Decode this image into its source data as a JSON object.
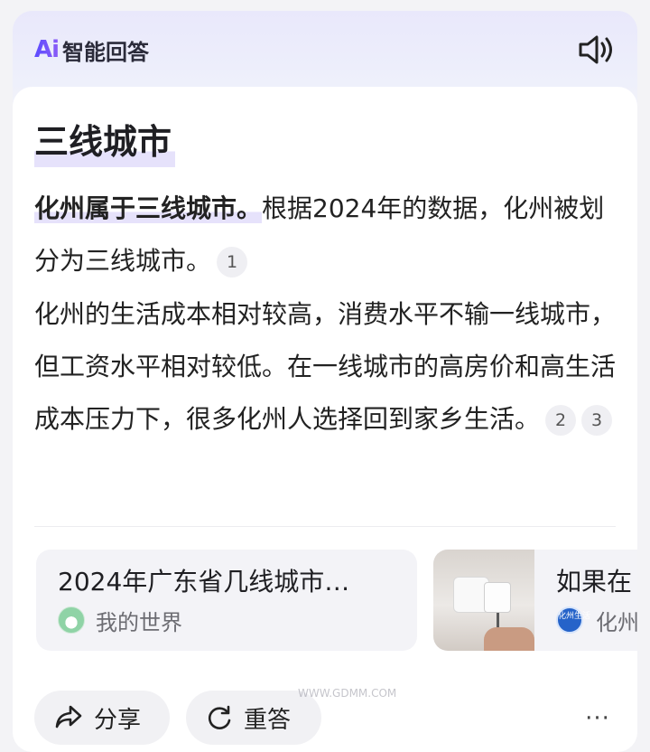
{
  "header": {
    "logo_mark": "Ai",
    "title": "智能回答",
    "speaker_icon": "speaker-icon"
  },
  "answer": {
    "heading": "三线城市",
    "p1_highlight": "化州属于三线城市。",
    "p1_text": "根据2024年的数据，化州被划分为三线城市。",
    "p1_cites": [
      "1"
    ],
    "p2_text": "化州的生活成本相对较高，消费水平不输一线城市，但工资水平相对较低。在一线城市的高房价和高生活成本压力下，很多化州人选择回到家乡生活。",
    "p2_cites": [
      "2",
      "3"
    ]
  },
  "sources": [
    {
      "title": "2024年广东省几线城市…",
      "site": "我的世界",
      "avatar_icon": "site-avatar-icon"
    },
    {
      "title": "如果在",
      "site": "化州",
      "avatar_icon": "site-avatar-icon",
      "avatar_text": "化州生活"
    }
  ],
  "actions": {
    "share_label": "分享",
    "redo_label": "重答",
    "more_label": "···"
  },
  "watermark": "WWW.GDMM.COM",
  "colors": {
    "accent": "#6a4cff",
    "highlight": "#e6e2fb",
    "card_bg": "#f3f3f7"
  }
}
